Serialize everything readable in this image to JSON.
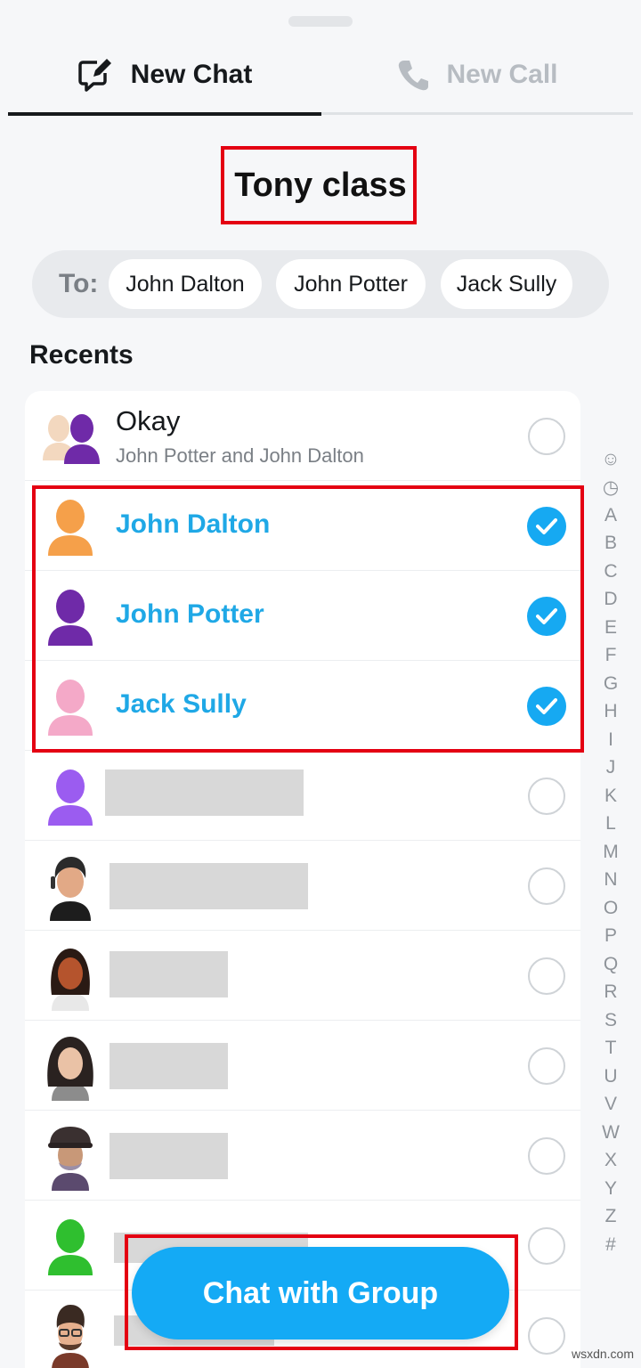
{
  "tabs": [
    {
      "label": "New Chat",
      "icon": "new-chat-icon",
      "active": true
    },
    {
      "label": "New Call",
      "icon": "phone-icon",
      "active": false
    }
  ],
  "title": "Tony class",
  "to": {
    "label": "To:",
    "chips": [
      "John Dalton",
      "John Potter",
      "Jack Sully"
    ]
  },
  "recents_label": "Recents",
  "recents": [
    {
      "name": "Okay",
      "subtitle": "John Potter and John Dalton",
      "avatar": "group-avatar-icon",
      "selected": false
    },
    {
      "name": "John Dalton",
      "avatar": "orange-person-icon",
      "selected": true
    },
    {
      "name": "John Potter",
      "avatar": "purple-person-icon",
      "selected": true
    },
    {
      "name": "Jack Sully",
      "avatar": "pink-person-icon",
      "selected": true
    }
  ],
  "index_letters": [
    "☺",
    "◷",
    "A",
    "B",
    "C",
    "D",
    "E",
    "F",
    "G",
    "H",
    "I",
    "J",
    "K",
    "L",
    "M",
    "N",
    "O",
    "P",
    "Q",
    "R",
    "S",
    "T",
    "U",
    "V",
    "W",
    "X",
    "Y",
    "Z",
    "#"
  ],
  "cta_label": "Chat with Group",
  "watermark": "wsxdn.com",
  "colors": {
    "accent": "#14aaf5",
    "selected_name": "#1fa8e6",
    "highlight": "#e40012"
  }
}
